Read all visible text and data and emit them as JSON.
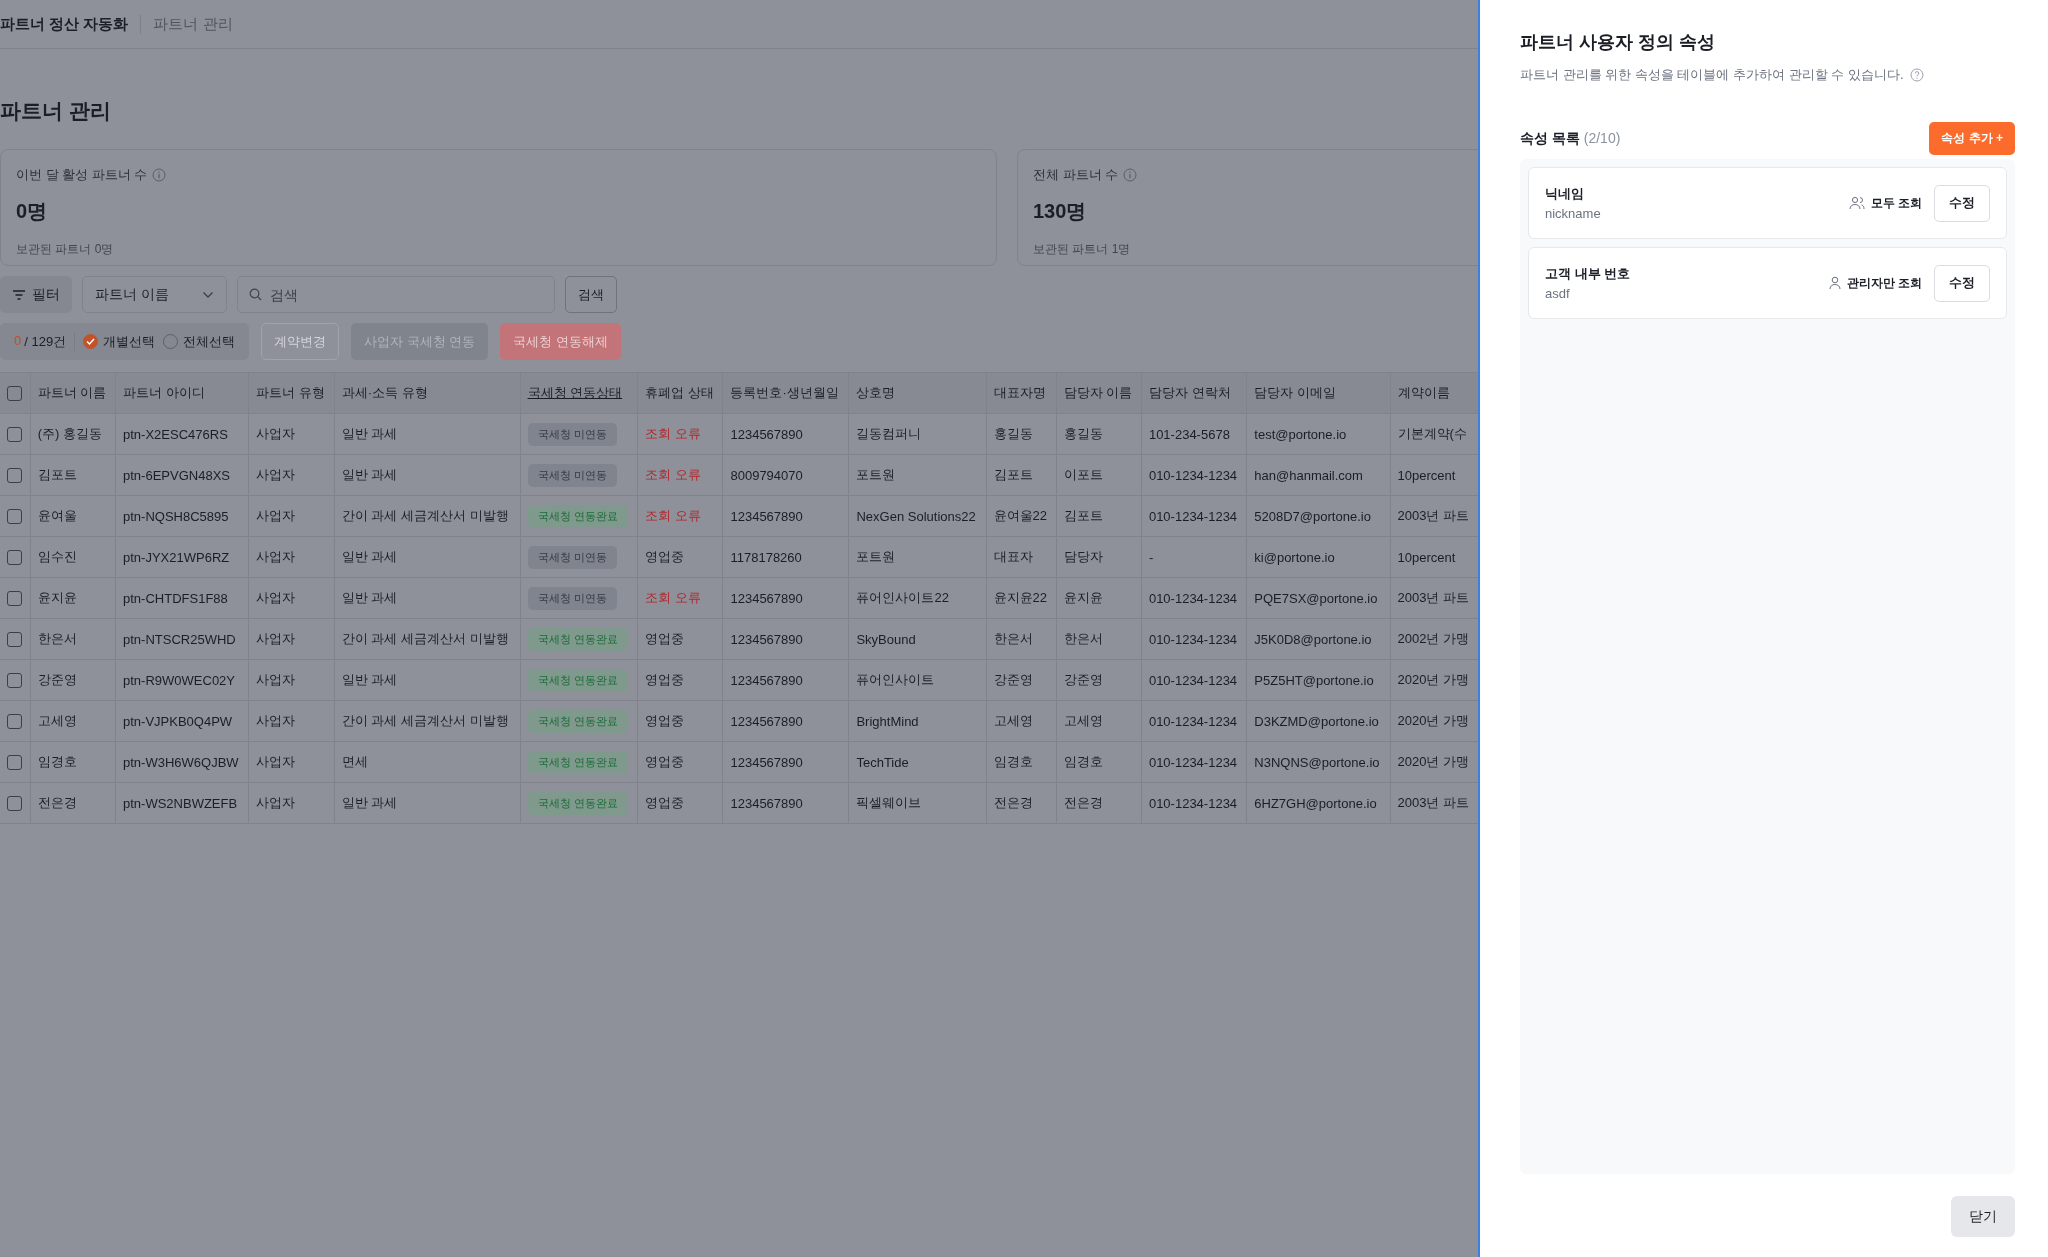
{
  "breadcrumb": [
    {
      "label": "파트너 정산 자동화"
    },
    {
      "label": "파트너 관리"
    }
  ],
  "page_title": "파트너 관리",
  "stats": [
    {
      "label": "이번 달 활성 파트너 수",
      "value": "0명",
      "sub": "보관된 파트너 0명"
    },
    {
      "label": "전체 파트너 수",
      "value": "130명",
      "sub": "보관된 파트너 1명"
    }
  ],
  "filter": {
    "filter_button": "필터",
    "field_select": "파트너 이름",
    "search": {
      "placeholder": "검색"
    },
    "search_button": "검색"
  },
  "selection": {
    "selected_count": "0",
    "total": "/ 129건",
    "modes": [
      {
        "label": "개별선택",
        "selected": true
      },
      {
        "label": "전체선택",
        "selected": false
      }
    ]
  },
  "actions": [
    {
      "label": "계약변경",
      "kind": "outline"
    },
    {
      "label": "사업자 국세청 연동",
      "kind": "gray"
    },
    {
      "label": "국세청 연동해제",
      "kind": "danger"
    }
  ],
  "table": {
    "header_checked": false,
    "columns": [
      {
        "label": "파트너 이름",
        "sortable": false
      },
      {
        "label": "파트너 아이디",
        "sortable": false
      },
      {
        "label": "파트너 유형",
        "sortable": false
      },
      {
        "label": "과세·소득 유형",
        "sortable": false
      },
      {
        "label": "국세청 연동상태",
        "sortable": true
      },
      {
        "label": "휴폐업 상태",
        "sortable": false
      },
      {
        "label": "등록번호·생년월일",
        "sortable": false
      },
      {
        "label": "상호명",
        "sortable": false
      },
      {
        "label": "대표자명",
        "sortable": false
      },
      {
        "label": "담당자 이름",
        "sortable": false
      },
      {
        "label": "담당자 연락처",
        "sortable": false
      },
      {
        "label": "담당자 이메일",
        "sortable": false
      },
      {
        "label": "계약이름",
        "sortable": false
      }
    ],
    "rows": [
      {
        "checked": false,
        "name": "(주) 홍길동",
        "id": "ptn-X2ESC476RS",
        "type": "사업자",
        "tax": "일반 과세",
        "nts": {
          "label": "국세청 미연동",
          "kind": "unlinked"
        },
        "biz": {
          "label": "조회 오류",
          "kind": "error"
        },
        "regno": "1234567890",
        "company": "길동컴퍼니",
        "rep": "홍길동",
        "manager": "홍길동",
        "phone": "101-234-5678",
        "email": "test@portone.io",
        "contract": "기본계약(수"
      },
      {
        "checked": false,
        "name": "김포트",
        "id": "ptn-6EPVGN48XS",
        "type": "사업자",
        "tax": "일반 과세",
        "nts": {
          "label": "국세청 미연동",
          "kind": "unlinked"
        },
        "biz": {
          "label": "조회 오류",
          "kind": "error"
        },
        "regno": "8009794070",
        "company": "포트원",
        "rep": "김포트",
        "manager": "이포트",
        "phone": "010-1234-1234",
        "email": "han@hanmail.com",
        "contract": "10percent"
      },
      {
        "checked": false,
        "name": "윤여울",
        "id": "ptn-NQSH8C5895",
        "type": "사업자",
        "tax": "간이 과세 세금계산서 미발행",
        "nts": {
          "label": "국세청 연동완료",
          "kind": "linked"
        },
        "biz": {
          "label": "조회 오류",
          "kind": "error"
        },
        "regno": "1234567890",
        "company": "NexGen Solutions22",
        "rep": "윤여울22",
        "manager": "김포트",
        "phone": "010-1234-1234",
        "email": "5208D7@portone.io",
        "contract": "2003년 파트"
      },
      {
        "checked": false,
        "name": "임수진",
        "id": "ptn-JYX21WP6RZ",
        "type": "사업자",
        "tax": "일반 과세",
        "nts": {
          "label": "국세청 미연동",
          "kind": "unlinked"
        },
        "biz": {
          "label": "영업중",
          "kind": "normal"
        },
        "regno": "1178178260",
        "company": "포트원",
        "rep": "대표자",
        "manager": "담당자",
        "phone": "-",
        "email": "ki@portone.io",
        "contract": "10percent"
      },
      {
        "checked": false,
        "name": "윤지윤",
        "id": "ptn-CHTDFS1F88",
        "type": "사업자",
        "tax": "일반 과세",
        "nts": {
          "label": "국세청 미연동",
          "kind": "unlinked"
        },
        "biz": {
          "label": "조회 오류",
          "kind": "error"
        },
        "regno": "1234567890",
        "company": "퓨어인사이트22",
        "rep": "윤지윤22",
        "manager": "윤지윤",
        "phone": "010-1234-1234",
        "email": "PQE7SX@portone.io",
        "contract": "2003년 파트"
      },
      {
        "checked": false,
        "name": "한은서",
        "id": "ptn-NTSCR25WHD",
        "type": "사업자",
        "tax": "간이 과세 세금계산서 미발행",
        "nts": {
          "label": "국세청 연동완료",
          "kind": "linked"
        },
        "biz": {
          "label": "영업중",
          "kind": "normal"
        },
        "regno": "1234567890",
        "company": "SkyBound",
        "rep": "한은서",
        "manager": "한은서",
        "phone": "010-1234-1234",
        "email": "J5K0D8@portone.io",
        "contract": "2002년 가맹"
      },
      {
        "checked": false,
        "name": "강준영",
        "id": "ptn-R9W0WEC02Y",
        "type": "사업자",
        "tax": "일반 과세",
        "nts": {
          "label": "국세청 연동완료",
          "kind": "linked"
        },
        "biz": {
          "label": "영업중",
          "kind": "normal"
        },
        "regno": "1234567890",
        "company": "퓨어인사이트",
        "rep": "강준영",
        "manager": "강준영",
        "phone": "010-1234-1234",
        "email": "P5Z5HT@portone.io",
        "contract": "2020년 가맹"
      },
      {
        "checked": false,
        "name": "고세영",
        "id": "ptn-VJPKB0Q4PW",
        "type": "사업자",
        "tax": "간이 과세 세금계산서 미발행",
        "nts": {
          "label": "국세청 연동완료",
          "kind": "linked"
        },
        "biz": {
          "label": "영업중",
          "kind": "normal"
        },
        "regno": "1234567890",
        "company": "BrightMind",
        "rep": "고세영",
        "manager": "고세영",
        "phone": "010-1234-1234",
        "email": "D3KZMD@portone.io",
        "contract": "2020년 가맹"
      },
      {
        "checked": false,
        "name": "임경호",
        "id": "ptn-W3H6W6QJBW",
        "type": "사업자",
        "tax": "면세",
        "nts": {
          "label": "국세청 연동완료",
          "kind": "linked"
        },
        "biz": {
          "label": "영업중",
          "kind": "normal"
        },
        "regno": "1234567890",
        "company": "TechTide",
        "rep": "임경호",
        "manager": "임경호",
        "phone": "010-1234-1234",
        "email": "N3NQNS@portone.io",
        "contract": "2020년 가맹"
      },
      {
        "checked": false,
        "name": "전은경",
        "id": "ptn-WS2NBWZEFB",
        "type": "사업자",
        "tax": "일반 과세",
        "nts": {
          "label": "국세청 연동완료",
          "kind": "linked"
        },
        "biz": {
          "label": "영업중",
          "kind": "normal"
        },
        "regno": "1234567890",
        "company": "픽셀웨이브",
        "rep": "전은경",
        "manager": "전은경",
        "phone": "010-1234-1234",
        "email": "6HZ7GH@portone.io",
        "contract": "2003년 파트"
      }
    ]
  },
  "panel": {
    "title": "파트너 사용자 정의 속성",
    "description": "파트너 관리를 위한 속성을 테이블에 추가하여 관리할 수 있습니다.",
    "list_title": "속성 목록",
    "list_count": "(2/10)",
    "add_button": "속성 추가 +",
    "attributes": [
      {
        "name": "닉네임",
        "key": "nickname",
        "visibility": "모두 조회",
        "kind": "all",
        "edit_button": "수정"
      },
      {
        "name": "고객 내부 번호",
        "key": "asdf",
        "visibility": "관리자만 조회",
        "kind": "admin",
        "edit_button": "수정"
      }
    ],
    "close_button": "닫기"
  }
}
